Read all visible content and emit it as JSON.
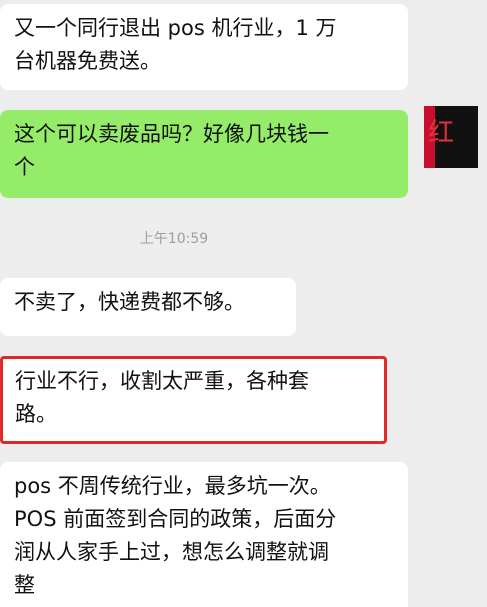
{
  "messages": [
    {
      "sender": "other",
      "lines": [
        "又一个同行退出 pos 机行业，1 万",
        "台机器免费送。"
      ]
    },
    {
      "sender": "self",
      "lines": [
        "这个可以卖废品吗？好像几块钱一",
        "个"
      ]
    },
    {
      "sender": "other",
      "lines": [
        "不卖了，快递费都不够。"
      ]
    },
    {
      "sender": "other",
      "highlighted": true,
      "lines": [
        "行业不行，收割太严重，各种套",
        "路。"
      ]
    },
    {
      "sender": "other",
      "lines": [
        "pos 不周传统行业，最多坑一次。",
        "POS 前面签到合同的政策，后面分",
        "润从人家手上过，想怎么调整就调",
        "整"
      ]
    }
  ],
  "timestamp": "上午10:59",
  "avatar": {
    "glyph": "红",
    "colors": {
      "background": "#111111",
      "accent": "#c8102e",
      "glyph": "#e4303a"
    }
  },
  "colors": {
    "page_background": "#ededed",
    "incoming_bubble": "#ffffff",
    "outgoing_bubble": "#95ec69",
    "highlight_border": "#e02a2a",
    "timestamp_text": "#9e9e9e"
  }
}
